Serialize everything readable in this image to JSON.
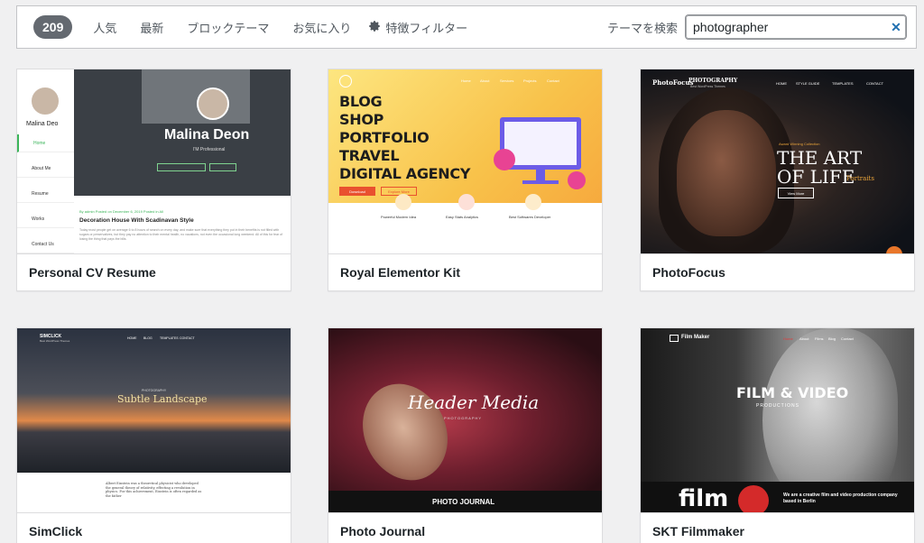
{
  "filter": {
    "count": "209",
    "links": [
      "人気",
      "最新",
      "ブロックテーマ",
      "お気に入り"
    ],
    "feature_filter": "特徴フィルター",
    "search_label": "テーマを検索",
    "search_value": "photographer"
  },
  "themes": [
    {
      "name": "Personal CV Resume",
      "preview": {
        "side_name": "Malina Deo",
        "nav": [
          "Home",
          "About Me",
          "Resume",
          "Works",
          "Contact Us"
        ],
        "hero_name": "Malina Deon",
        "hero_sub": "I'M Professional",
        "post_meta": "By admin Posted on December 6, 2019 Posted in All",
        "post_title": "Decoration House With Scadinavan Style",
        "post_excerpt": "Today most people get on average 6 to 8 hours of search on every day, and make sure that everything they put in their benefits is not filled with sugars or preservatives, but they pay no attention to their mental health, no vacations, not even the occasional long weekend. All of this for fear of losing the thing that pays the bills."
      }
    },
    {
      "name": "Royal Elementor Kit",
      "preview": {
        "headline": [
          "BLOG",
          "SHOP",
          "PORTFOLIO",
          "TRAVEL",
          "DIGITAL AGENCY"
        ],
        "nav": [
          "Home",
          "About",
          "Services",
          "Projects",
          "Contact"
        ],
        "buttons": [
          "Download",
          "Explore More"
        ],
        "features": [
          "Powerful Modern Idea",
          "Easy Stats Analytics",
          "Best Softwares Developer"
        ]
      }
    },
    {
      "name": "PhotoFocus",
      "preview": {
        "logo": "PhotoFocus",
        "brand": "PHOTOGRAPHY",
        "tagline": "Best WordPress Themes",
        "nav": [
          "HOME",
          "STYLE GUIDE",
          "TEMPLATES",
          "CONTACT"
        ],
        "kicker": "Award Winning Collection",
        "headline1": "THE ART",
        "headline2": "OF LIFE",
        "accent": "Portraits",
        "button": "View More"
      }
    },
    {
      "name": "SimClick",
      "preview": {
        "logo": "SIMCLICK",
        "tagline": "Best WordPress Themes",
        "nav": [
          "HOME",
          "BLOG",
          "TEMPLATES",
          "CONTACT"
        ],
        "kicker": "PHOTOGRAPHY",
        "title": "Subtle Landscape",
        "body": "Albert Einstein was a theoretical physicist who developed the general theory of relativity, effecting a revolution in physics. For this achievement, Einstein is often regarded as the father"
      }
    },
    {
      "name": "Photo Journal",
      "preview": {
        "title": "Header Media",
        "subtitle": "PHOTOGRAPHY",
        "footer": "PHOTO JOURNAL"
      }
    },
    {
      "name": "SKT Filmmaker",
      "preview": {
        "logo": "Film Maker",
        "nav": [
          "Home",
          "About",
          "Films",
          "Blog",
          "Contact"
        ],
        "title": "FILM & VIDEO",
        "subtitle": "PRODUCTIONS",
        "big_word": "film",
        "blurb": "We are a creative film and video production company based in Berlin"
      }
    }
  ]
}
